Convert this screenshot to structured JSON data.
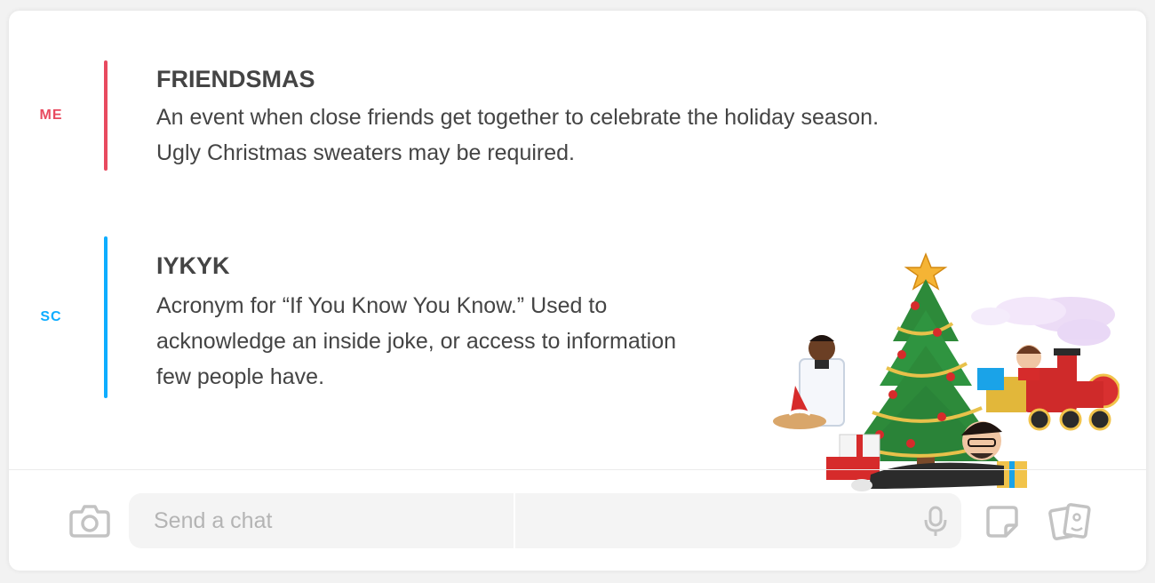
{
  "messages": [
    {
      "sender": "ME",
      "sender_color": "#e84a5f",
      "title": "FRIENDSMAS",
      "body": "An event when close friends get together to celebrate the holiday season. Ugly Christmas sweaters may be required."
    },
    {
      "sender": "SC",
      "sender_color": "#0eadff",
      "title": "IYKYK",
      "body": "Acronym for “If You Know You Know.” Used to acknowledge an inside joke, or access to information few people have."
    }
  ],
  "composer": {
    "placeholder": "Send a chat",
    "icons": [
      "camera-icon",
      "microphone-icon",
      "sticker-icon",
      "cards-icon"
    ]
  },
  "sticker": {
    "name": "christmas-tree-bitmoji-sticker"
  }
}
